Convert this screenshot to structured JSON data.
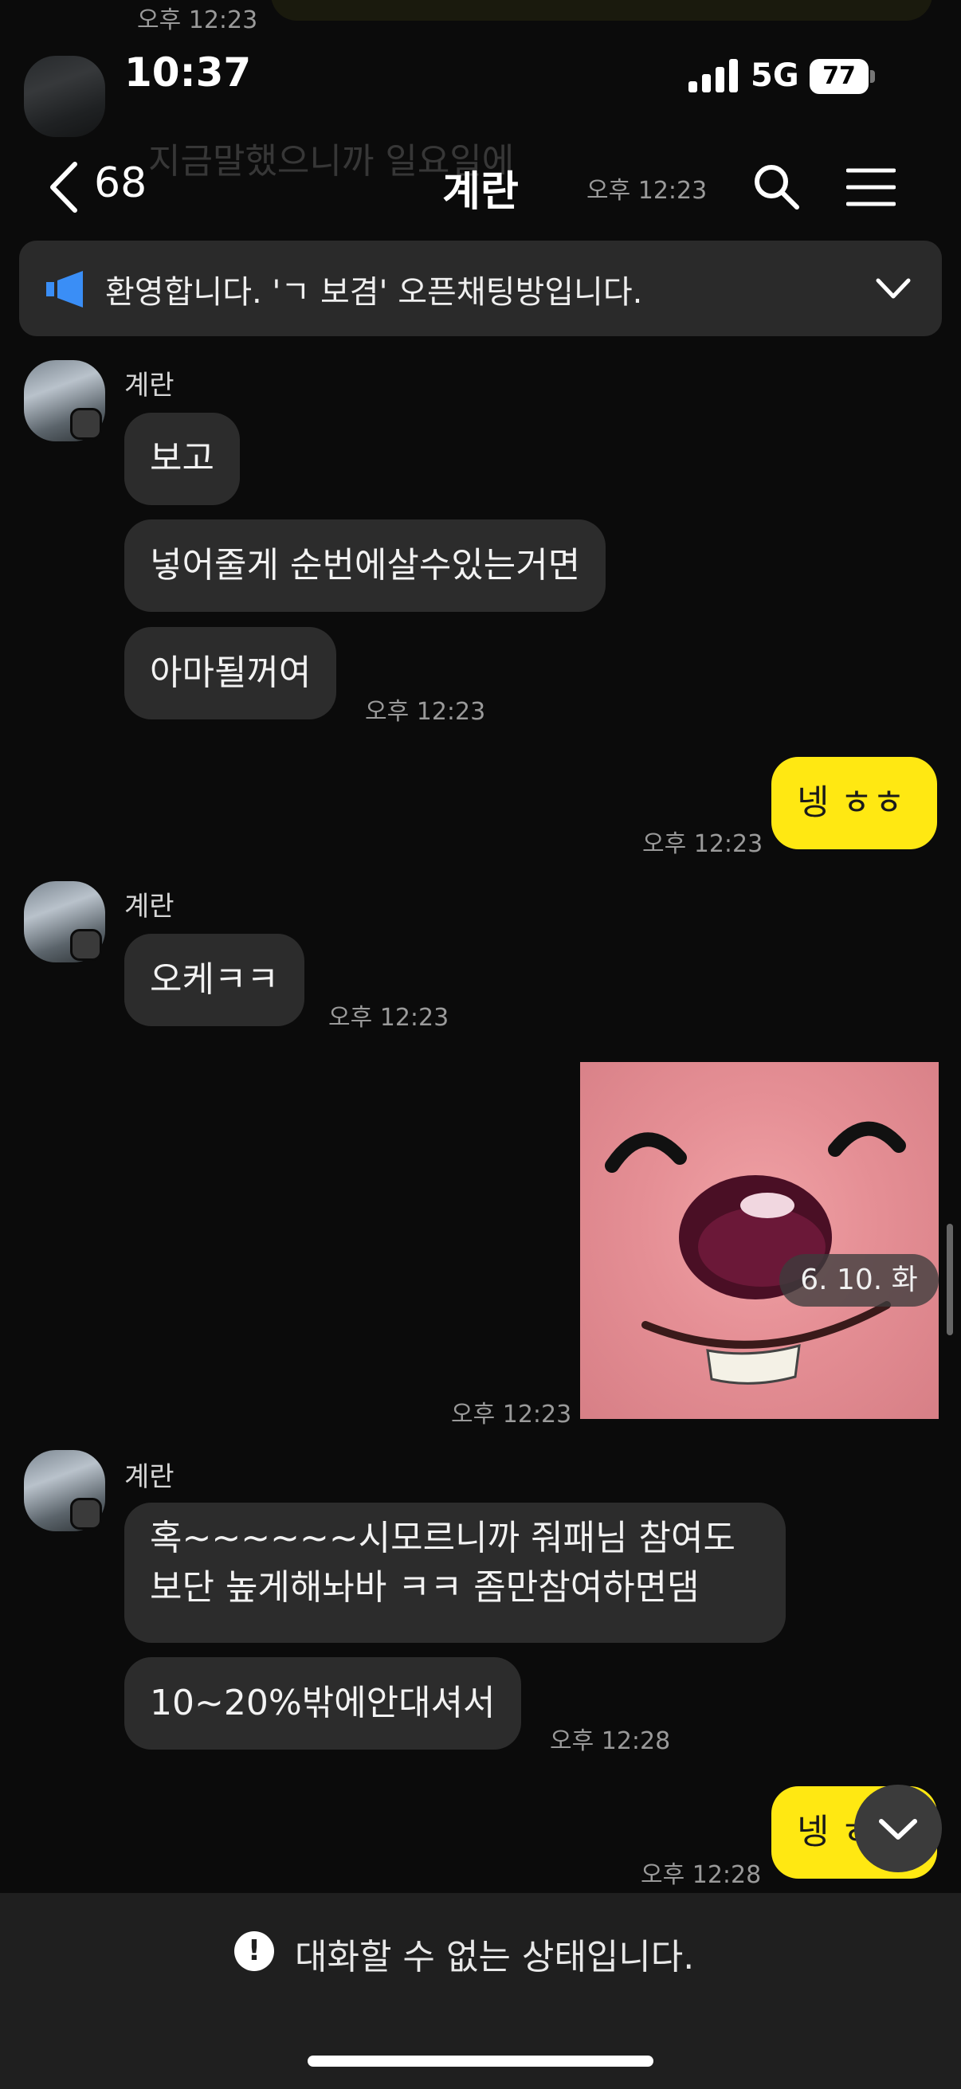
{
  "status_bar": {
    "time": "10:37",
    "network": "5G",
    "battery": "77"
  },
  "ghost": {
    "time_top": "오후 12:23",
    "message": "지금말했으니까 일요일에",
    "time_mid": "오후 12:23"
  },
  "header": {
    "back_count": "68",
    "title": "계란"
  },
  "notice": {
    "text": "환영합니다. 'ㄱ 보겸' 오픈채팅방입니다."
  },
  "messages": {
    "group1": {
      "sender": "계란",
      "b1": "보고",
      "b2": "넣어줄게 순번에살수있는거면",
      "b3": "아마될꺼여",
      "time": "오후 12:23"
    },
    "me1": {
      "text": "넹 ㅎㅎ",
      "time": "오후 12:23"
    },
    "group2": {
      "sender": "계란",
      "b1": "오케ㅋㅋ",
      "time": "오후 12:23"
    },
    "image": {
      "date": "6. 10. 화",
      "time": "오후 12:23"
    },
    "group3": {
      "sender": "계란",
      "b1": "혹~~~~~~시모르니까 줘패님 참여도보단 높게해놔바 ㅋㅋ 좀만참여하면댐",
      "b2": "10~20%밖에안대셔서",
      "time": "오후 12:28"
    },
    "me2": {
      "text": "넹 ㅎ",
      "time": "오후 12:28"
    }
  },
  "bottom": {
    "disabled_text": "대화할 수 없는 상태입니다.",
    "warn_glyph": "!"
  },
  "colors": {
    "my_bubble": "#ffe812",
    "their_bubble": "#2c2c2c",
    "background": "#0b0b0b",
    "notice_icon": "#3a8ef6"
  }
}
